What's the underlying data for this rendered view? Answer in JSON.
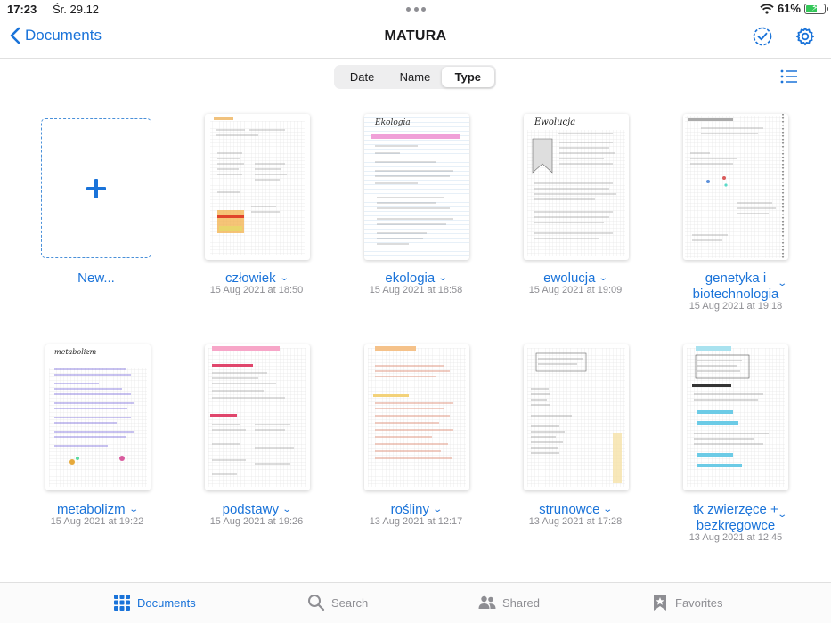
{
  "status": {
    "time": "17:23",
    "date": "Śr. 29.12",
    "battery": "61%",
    "battery_level": 0.61
  },
  "nav": {
    "back_label": "Documents",
    "title": "MATURA"
  },
  "sort": {
    "options": [
      "Date",
      "Name",
      "Type"
    ],
    "selected": "Type"
  },
  "new_item": {
    "label": "New..."
  },
  "documents": [
    {
      "name": "człowiek",
      "date": "15 Aug 2021 at 18:50"
    },
    {
      "name": "ekologia",
      "date": "15 Aug 2021 at 18:58"
    },
    {
      "name": "ewolucja",
      "date": "15 Aug 2021 at 19:09"
    },
    {
      "name_line1": "genetyka i",
      "name_line2": "biotechnologia",
      "date": "15 Aug 2021 at 19:18"
    },
    {
      "name": "metabolizm",
      "date": "15 Aug 2021 at 19:22"
    },
    {
      "name": "podstawy",
      "date": "15 Aug 2021 at 19:26"
    },
    {
      "name": "rośliny",
      "date": "13 Aug 2021 at 12:17"
    },
    {
      "name": "strunowce",
      "date": "13 Aug 2021 at 17:28"
    },
    {
      "name_line1": "tk zwierzęce +",
      "name_line2": "bezkręgowce",
      "date": "13 Aug 2021 at 12:45"
    }
  ],
  "thumb_headings": [
    "Ekologia",
    "Ewolucja",
    "metabolizm"
  ],
  "tabs": [
    {
      "label": "Documents",
      "icon": "grid-icon",
      "active": true
    },
    {
      "label": "Search",
      "icon": "magnifier-icon",
      "active": false
    },
    {
      "label": "Shared",
      "icon": "people-icon",
      "active": false
    },
    {
      "label": "Favorites",
      "icon": "bookmark-star-icon",
      "active": false
    }
  ],
  "colors": {
    "accent": "#1a73d9",
    "secondary_text": "#8e8e93",
    "battery": "#34c759"
  }
}
